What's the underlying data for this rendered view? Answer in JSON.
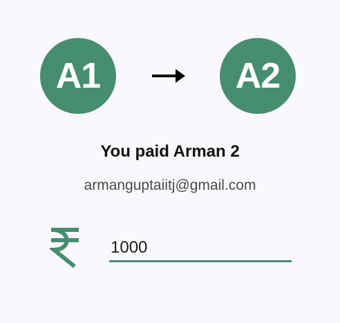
{
  "payment": {
    "from_initials": "A1",
    "to_initials": "A2",
    "title": "You paid Arman 2",
    "recipient_email": "armanguptaiitj@gmail.com",
    "amount": "1000",
    "currency_icon": "rupee-icon",
    "arrow_icon": "arrow-right-icon"
  },
  "colors": {
    "accent": "#468e6f",
    "background": "#fbf8fd",
    "text_primary": "#111111",
    "text_secondary": "#4a4a4a"
  }
}
